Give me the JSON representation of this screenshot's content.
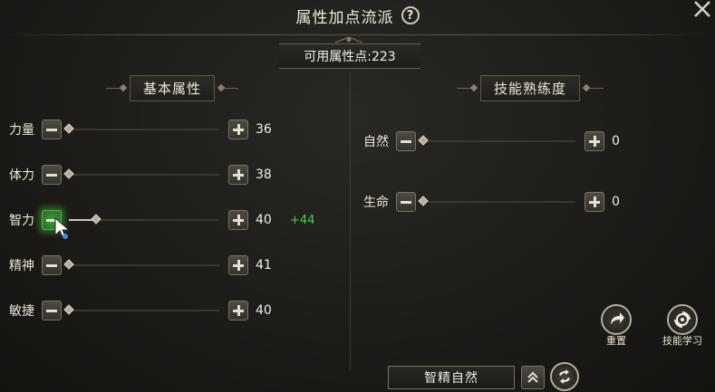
{
  "window": {
    "title": "属性加点流派",
    "help_icon": "?",
    "close_icon": "close-icon"
  },
  "available_points": {
    "text": "可用属性点:223"
  },
  "basic_attributes": {
    "header": "基本属性",
    "rows": [
      {
        "label": "力量",
        "value": "36",
        "fill": 0.0,
        "bonus": ""
      },
      {
        "label": "体力",
        "value": "38",
        "fill": 0.0,
        "bonus": ""
      },
      {
        "label": "智力",
        "value": "40",
        "fill": 0.18,
        "bonus": "+44"
      },
      {
        "label": "精神",
        "value": "41",
        "fill": 0.0,
        "bonus": ""
      },
      {
        "label": "敏捷",
        "value": "40",
        "fill": 0.0,
        "bonus": ""
      }
    ]
  },
  "skill_proficiency": {
    "header": "技能熟练度",
    "rows": [
      {
        "label": "自然",
        "value": "0",
        "fill": 0.0
      },
      {
        "label": "生命",
        "value": "0",
        "fill": 0.0
      }
    ]
  },
  "actions": {
    "reset_label": "重置",
    "skill_learn_label": "技能学习"
  },
  "preset": {
    "name": "智精自然"
  },
  "colors": {
    "bonus_green": "#3dd63d",
    "active_button": "#2a7a28",
    "text": "#e8e2d3"
  }
}
